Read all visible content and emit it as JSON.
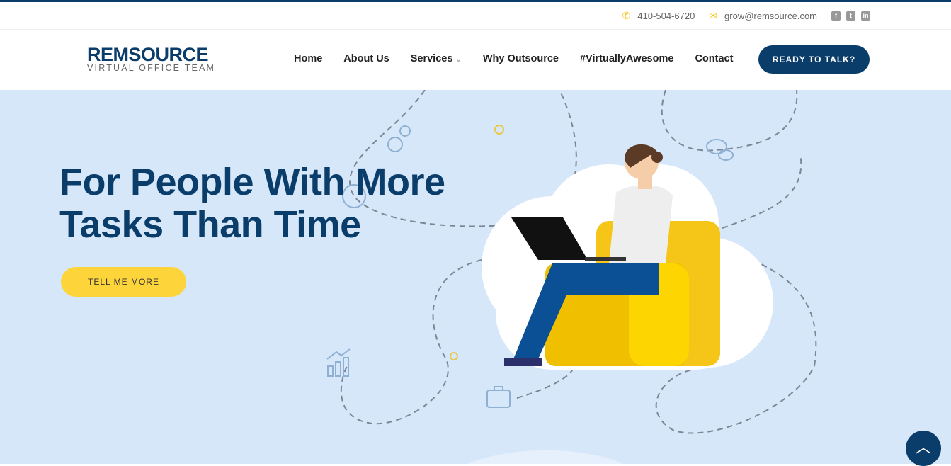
{
  "topbar": {
    "phone": "410-504-6720",
    "email": "grow@remsource.com",
    "social": [
      "facebook-icon",
      "twitter-icon",
      "linkedin-icon"
    ]
  },
  "logo": {
    "name": "REMSOURCE",
    "tagline": "VIRTUAL OFFICE TEAM"
  },
  "nav": {
    "items": [
      "Home",
      "About Us",
      "Services",
      "Why Outsource",
      "#VirtuallyAwesome",
      "Contact"
    ],
    "cta": "READY TO TALK?"
  },
  "hero": {
    "title_line1": "For People With More",
    "title_line2": "Tasks Than Time",
    "button": "TELL ME MORE"
  },
  "colors": {
    "primary": "#0b3d6b",
    "accent": "#fdd43a",
    "hero_bg": "#d6e7fa"
  }
}
